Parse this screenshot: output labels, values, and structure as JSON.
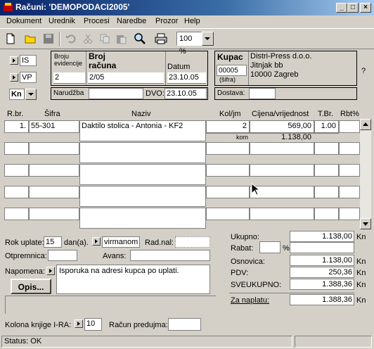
{
  "window": {
    "title": "Računi: 'DEMOPODACI2005'",
    "minimize": "_",
    "maximize": "□",
    "close": "×"
  },
  "menu": [
    "Dokument",
    "Urednik",
    "Procesi",
    "Naredbe",
    "Prozor",
    "Help"
  ],
  "toolbar": {
    "zoom": "100 %"
  },
  "doc": {
    "code1": "IS",
    "code2": "VP",
    "currency": "Kn",
    "broj_evidencije_label": "Broju evidencije",
    "broj_racuna_label": "Broj računa",
    "datum_label": "Datum",
    "broj_evidencije": "2",
    "broj_racuna": "2/05",
    "datum": "23.10.05",
    "narudzba_label": "Narudžba",
    "narudzba": "",
    "dvo_label": "DVO:",
    "dvo": "23.10.05",
    "kupac_label": "Kupac",
    "kupac_sifra": "00005",
    "sifra_label": "(šifra)",
    "kupac_line1": "Distri-Press d.o.o.",
    "kupac_line2": "Jitnjak bb",
    "kupac_line3": "10000 Zagreb",
    "question": "?",
    "dostava_label": "Dostava:",
    "dostava": ""
  },
  "table": {
    "headers": {
      "rbr": "R.br.",
      "sifra": "Šifra",
      "naziv": "Naziv",
      "kol": "Kol/jm",
      "cijena": "Cijena/vrijednost",
      "tbr": "T.Br.",
      "rbt": "Rbt%"
    },
    "rows": [
      {
        "rbr": "1.",
        "sifra": "55-301",
        "naziv": "Daktilo stolica - Antonia - KF2",
        "kol": "2",
        "cijena": "569,00",
        "tbr": "1.00",
        "rbt": "",
        "jm": "kom",
        "vrijednost": "1.138,00"
      }
    ]
  },
  "footer": {
    "rok_uplate_label": "Rok uplate:",
    "rok_uplate": "15",
    "dana_label": "dan(a).",
    "placanje": "virmanom",
    "radnal_label": "Rad.nal:",
    "radnal": "",
    "otpremnica_label": "Otpremnica:",
    "otpremnica": "",
    "avans_label": "Avans:",
    "avans": "",
    "napomena_label": "Napomena:",
    "napomena": "Isporuka na adresi kupca po uplati.",
    "opis_button": "Opis...",
    "kolona_label": "Kolona knjige I-RA:",
    "kolona": "10",
    "predujam_label": "Račun predujma:",
    "predujam": ""
  },
  "totals": {
    "ukupno_label": "Ukupno:",
    "ukupno": "1.138,00",
    "rabat_label": "Rabat:",
    "rabat_pct": "",
    "pct_sign": "%",
    "rabat": "",
    "osnovica_label": "Osnovica:",
    "osnovica": "1.138,00",
    "pdv_label": "PDV:",
    "pdv": "250,36",
    "sveukupno_label": "SVEUKUPNO:",
    "sveukupno": "1.388,36",
    "za_naplatu_label": "Za naplatu:",
    "za_naplatu": "1.388,36",
    "currency": "Kn"
  },
  "status": {
    "text": "Status: OK"
  }
}
